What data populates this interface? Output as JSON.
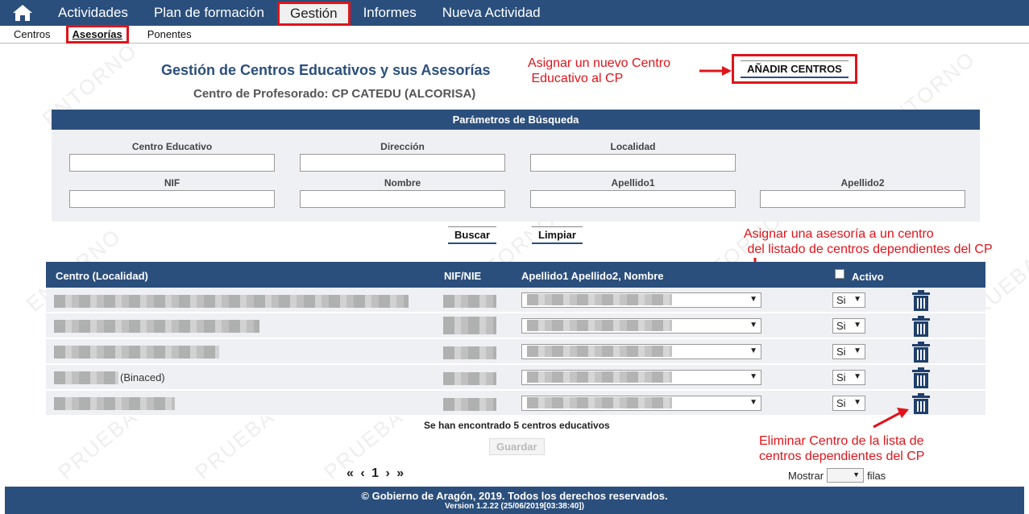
{
  "nav": {
    "items": [
      "Actividades",
      "Plan de formación",
      "Gestión",
      "Informes",
      "Nueva Actividad"
    ],
    "active": "Gestión"
  },
  "subnav": {
    "items": [
      "Centros",
      "Asesorías",
      "Ponentes"
    ],
    "active": "Asesorías"
  },
  "header": {
    "title": "Gestión de Centros Educativos y sus Asesorías",
    "subtitle": "Centro de Profesorado: CP CATEDU (ALCORISA)",
    "add_button": "AÑADIR CENTROS"
  },
  "annotations": {
    "add": "Asignar un nuevo Centro\n Educativo al CP",
    "assign": "Asignar una asesoría a un centro\n del listado de centros dependientes del CP",
    "delete": "Eliminar Centro de la lista de\ncentros dependientes del CP"
  },
  "search": {
    "title": "Parámetros de Búsqueda",
    "fields": [
      "Centro Educativo",
      "Dirección",
      "Localidad",
      "NIF",
      "Nombre",
      "Apellido1",
      "Apellido2"
    ],
    "buscar": "Buscar",
    "limpiar": "Limpiar"
  },
  "table": {
    "headers": {
      "centro": "Centro  (Localidad)",
      "nif": "NIF/NIE",
      "asesor": "Apellido1  Apellido2,  Nombre",
      "activo": "Activo"
    },
    "rows": [
      {
        "activo": "Si"
      },
      {
        "activo": "Si"
      },
      {
        "activo": "Si"
      },
      {
        "activo": "Si",
        "centro_fragment": "(Binaced)"
      },
      {
        "activo": "Si"
      }
    ]
  },
  "found": "Se han encontrado 5 centros educativos",
  "guardar": "Guardar",
  "pager": {
    "text": "« ‹ 1 › »"
  },
  "mostrar": {
    "label": "Mostrar",
    "suffix": "filas"
  },
  "footer": {
    "line1": "© Gobierno de Aragón, 2019. Todos los derechos reservados.",
    "line2": "Version 1.2.22 (25/06/2019[03:38:40])"
  },
  "colors": {
    "primary": "#2b4f7c",
    "annotation": "#e0141a"
  }
}
